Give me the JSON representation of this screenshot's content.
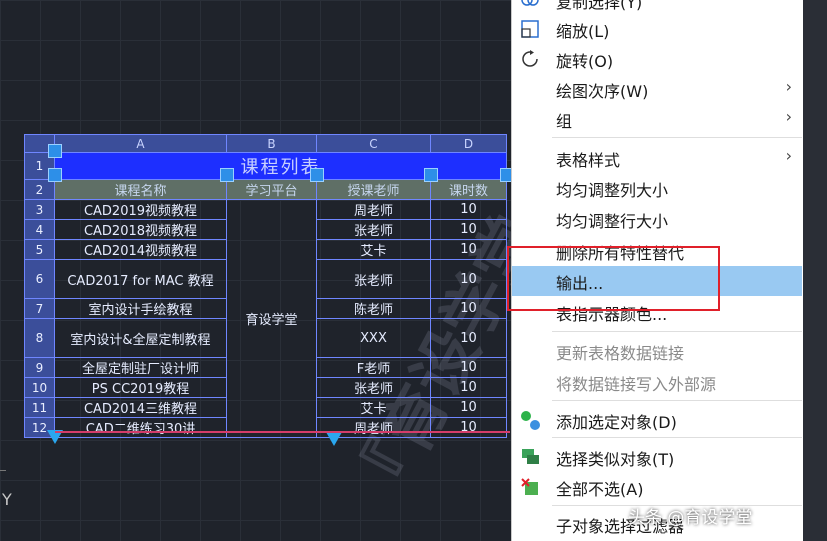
{
  "table": {
    "col_headers": [
      "A",
      "B",
      "C",
      "D"
    ],
    "row_numbers": [
      "1",
      "2",
      "3",
      "4",
      "5",
      "6",
      "7",
      "8",
      "9",
      "10",
      "11",
      "12"
    ],
    "title": "课程列表",
    "headers": [
      "课程名称",
      "学习平台",
      "授课老师",
      "课时数"
    ],
    "platform": "育设学堂",
    "rows": [
      {
        "name": "CAD2019视频教程",
        "teacher": "周老师",
        "hours": "10"
      },
      {
        "name": "CAD2018视频教程",
        "teacher": "张老师",
        "hours": "10"
      },
      {
        "name": "CAD2014视频教程",
        "teacher": "艾卡",
        "hours": "10"
      },
      {
        "name": "CAD2017 for MAC 教程",
        "teacher": "张老师",
        "hours": "10"
      },
      {
        "name": "室内设计手绘教程",
        "teacher": "陈老师",
        "hours": "10"
      },
      {
        "name": "室内设计&全屋定制教程",
        "teacher": "XXX",
        "hours": "10"
      },
      {
        "name": "全屋定制驻厂设计师",
        "teacher": "F老师",
        "hours": "10"
      },
      {
        "name": "PS CC2019教程",
        "teacher": "张老师",
        "hours": "10"
      },
      {
        "name": "CAD2014三维教程",
        "teacher": "艾卡",
        "hours": "10"
      },
      {
        "name": "CAD二维练习30讲",
        "teacher": "周老师",
        "hours": "10"
      }
    ]
  },
  "canvas": {
    "axis_label": "Y"
  },
  "menu": {
    "items": {
      "copy_select": "复制选择(Y)",
      "scale": "缩放(L)",
      "rotate": "旋转(O)",
      "draw_order": "绘图次序(W)",
      "group": "组",
      "table_style": "表格样式",
      "equalize_cols": "均匀调整列大小",
      "equalize_rows": "均匀调整行大小",
      "remove_overrides": "删除所有特性替代",
      "export": "输出...",
      "indicator_color": "表指示器颜色...",
      "update_link": "更新表格数据链接",
      "write_link": "将数据链接写入外部源",
      "add_selected": "添加选定对象(D)",
      "select_similar": "选择类似对象(T)",
      "deselect_all": "全部不选(A)",
      "subobject_filter": "子对象选择过滤器"
    },
    "submenu_arrow": "›"
  },
  "overlay": {
    "credit": "头条 @育设学堂",
    "watermark": "『育设学堂』出品"
  }
}
